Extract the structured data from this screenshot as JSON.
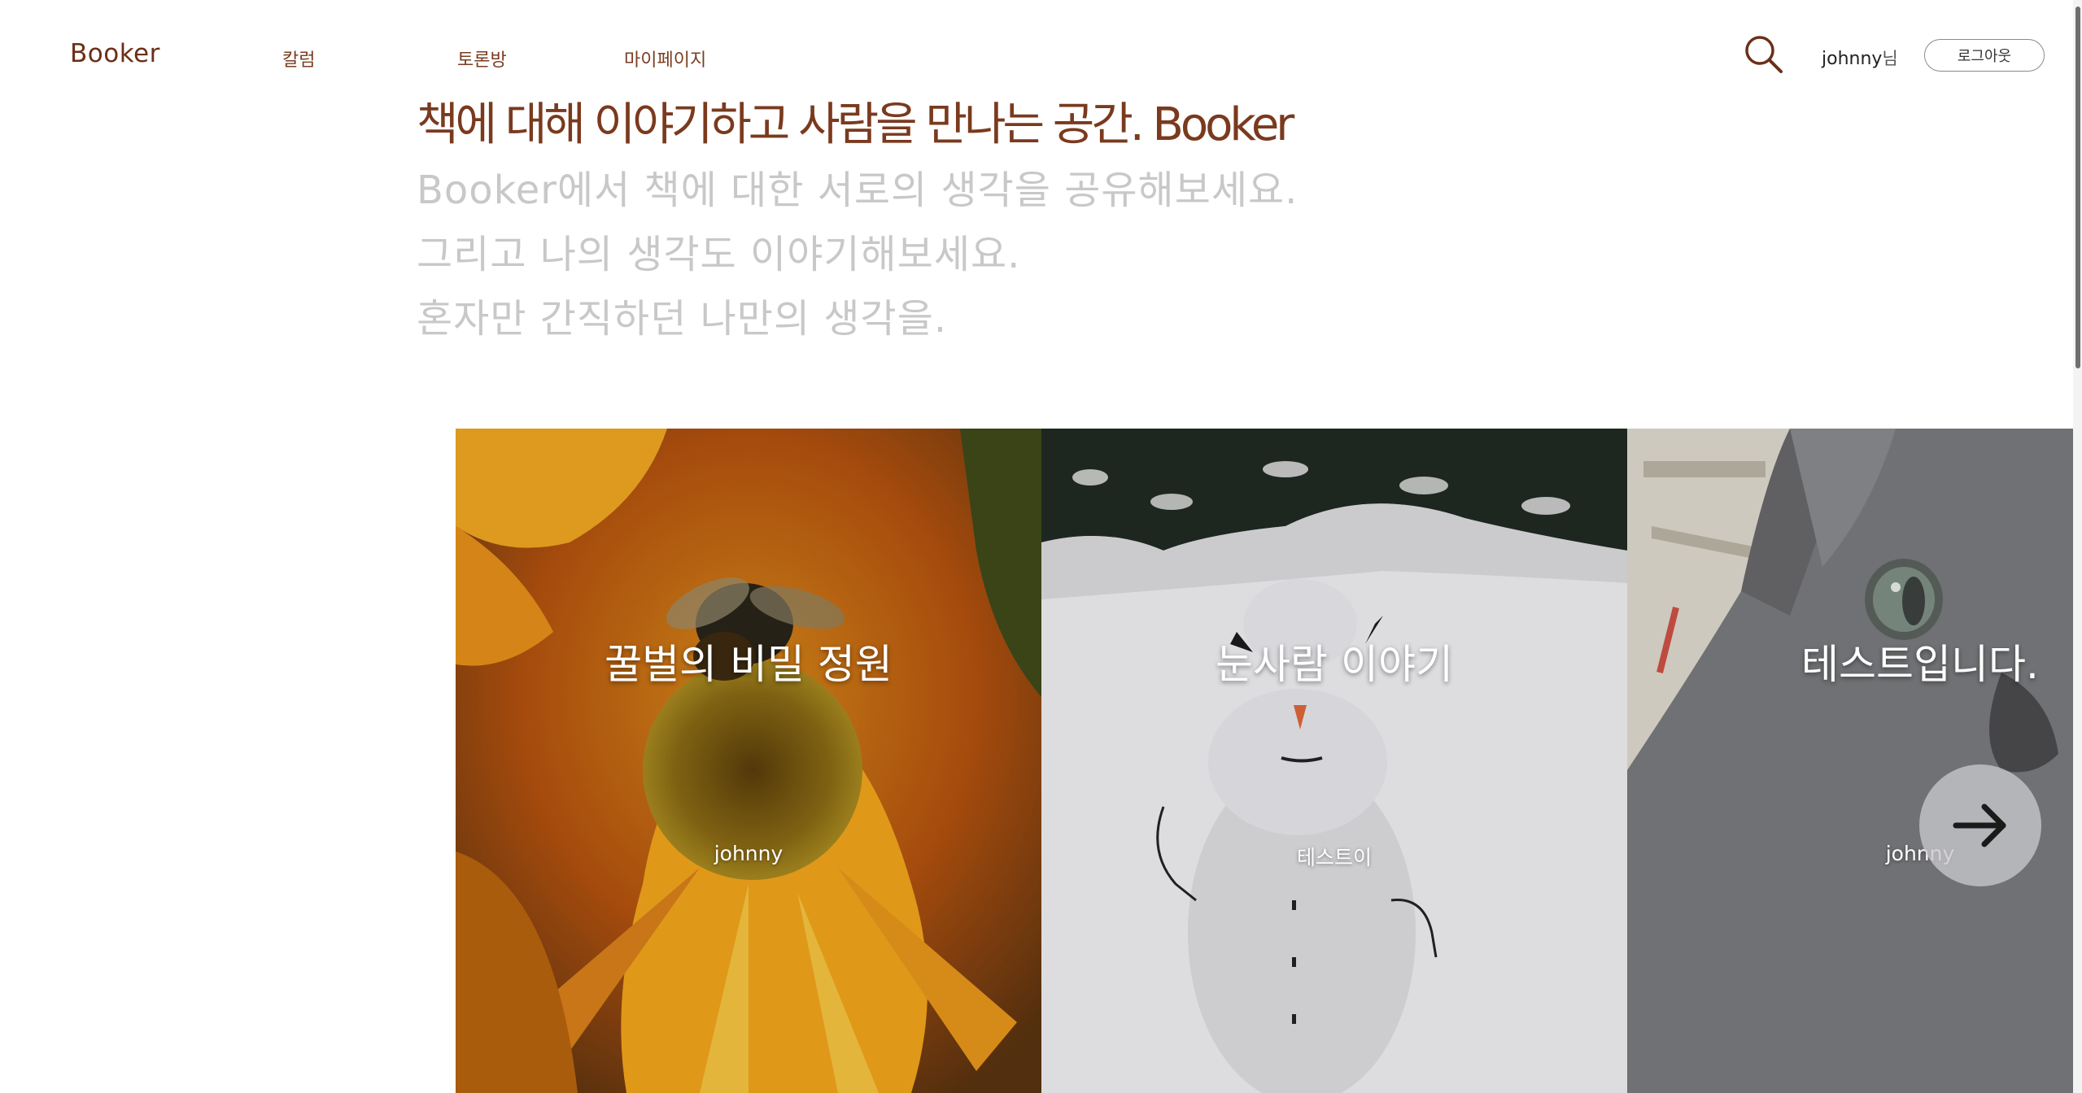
{
  "header": {
    "logo": "Booker",
    "nav": [
      "칼럼",
      "토론방",
      "마이페이지"
    ],
    "user_name": "johnny",
    "user_suffix": "님",
    "logout_label": "로그아웃"
  },
  "hero": {
    "headline": "책에 대해 이야기하고 사람을 만나는 공간. Booker",
    "lines": [
      "Booker에서 책에 대한 서로의 생각을 공유해보세요.",
      "그리고 나의 생각도 이야기해보세요.",
      "혼자만 간직하던 나만의 생각을."
    ]
  },
  "cards": [
    {
      "title": "꿀벌의 비밀 정원",
      "author": "johnny",
      "image": "bee-on-orange-flower"
    },
    {
      "title": "눈사람 이야기",
      "author": "테스트이",
      "image": "snowman"
    },
    {
      "title": "테스트입니다.",
      "author": "johnny",
      "image": "gray-cat"
    }
  ],
  "icons": {
    "search": "search-icon",
    "next": "arrow-right-icon"
  },
  "colors": {
    "brand": "#6b2f17",
    "nav_text": "#7a3d22",
    "hero_sub": "#c8c8c8"
  }
}
